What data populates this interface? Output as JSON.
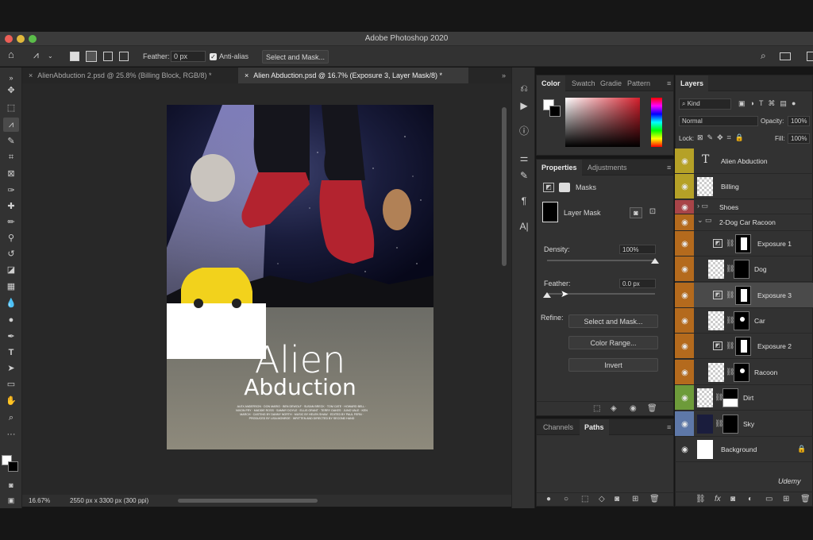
{
  "app": {
    "title": "Adobe Photoshop 2020"
  },
  "options_bar": {
    "feather_label": "Feather:",
    "feather_value": "0 px",
    "antialias_label": "Anti-alias",
    "antialias_checked": true,
    "select_mask_label": "Select and Mask..."
  },
  "tabs": [
    {
      "label": "AlienAbduction 2.psd @ 25.8% (Billing Block, RGB/8) *",
      "active": false
    },
    {
      "label": "Alien Abduction.psd @ 16.7% (Exposure 3, Layer Mask/8) *",
      "active": true
    }
  ],
  "poster": {
    "title_line1": "Alien",
    "title_line2": "Abduction",
    "billing": "ALEX ANDERSON · DON MARIO · BEN DEWOLF · SUSAN BRECK · TOM CATE · HOWARD BELL · NIXON FRY · MADDIE ROSS · SAMMY DOYLE · ELLIS GRANT · TERRY OAKES · JUNO VALE · KEN MARCH · CASTING BY DANNY NORTH · MUSIC BY HELEN SHAW · EDITED BY PAUL FERN · PRODUCED BY LISA MONROE · WRITTEN AND DIRECTED BY SECOND HAND"
  },
  "status": {
    "zoom": "16.67%",
    "doc_info": "2550 px x 3300 px (300 ppi)"
  },
  "color_panel": {
    "tabs": [
      "Color",
      "Swatch",
      "Gradie",
      "Pattern"
    ],
    "fg": "#ffffff",
    "bg": "#000000",
    "hue_color": "#d41f2c"
  },
  "properties": {
    "tabs": [
      "Properties",
      "Adjustments"
    ],
    "masks_label": "Masks",
    "layer_mask_label": "Layer Mask",
    "density_label": "Density:",
    "density_value": "100%",
    "density_fraction": 1.0,
    "feather_label": "Feather:",
    "feather_value": "0.0 px",
    "feather_fraction": 0.0,
    "refine_label": "Refine:",
    "buttons": [
      "Select and Mask...",
      "Color Range...",
      "Invert"
    ]
  },
  "channels_panel": {
    "tabs": [
      "Channels",
      "Paths"
    ]
  },
  "layers_panel": {
    "tab": "Layers",
    "kind_label": "Kind",
    "blend_mode": "Normal",
    "opacity_label": "Opacity:",
    "opacity_value": "100%",
    "lock_label": "Lock:",
    "fill_label": "Fill:",
    "fill_value": "100%",
    "layers": [
      {
        "name": "Alien Abduction",
        "type": "text",
        "color": "#b5a127"
      },
      {
        "name": "Billing",
        "type": "pixel",
        "color": "#b5a127"
      },
      {
        "name": "Shoes",
        "type": "group",
        "color": "#a84448"
      },
      {
        "name": "2-Dog Car Racoon",
        "type": "group-open",
        "color": "#b46a1d"
      },
      {
        "name": "Exposure 1",
        "type": "adjustment",
        "color": "#b46a1d"
      },
      {
        "name": "Dog",
        "type": "pixel-mask",
        "color": "#b46a1d"
      },
      {
        "name": "Exposure 3",
        "type": "adjustment",
        "color": "#b46a1d",
        "selected": true
      },
      {
        "name": "Car",
        "type": "pixel-mask",
        "color": "#b46a1d"
      },
      {
        "name": "Exposure 2",
        "type": "adjustment",
        "color": "#b46a1d"
      },
      {
        "name": "Racoon",
        "type": "pixel-mask",
        "color": "#b46a1d"
      },
      {
        "name": "Dirt",
        "type": "pixel-mask",
        "color": "#6d9b3a"
      },
      {
        "name": "Sky",
        "type": "pixel-mask",
        "color": "#5e78a8"
      },
      {
        "name": "Background",
        "type": "background",
        "color": ""
      }
    ]
  },
  "watermark": "Udemy"
}
